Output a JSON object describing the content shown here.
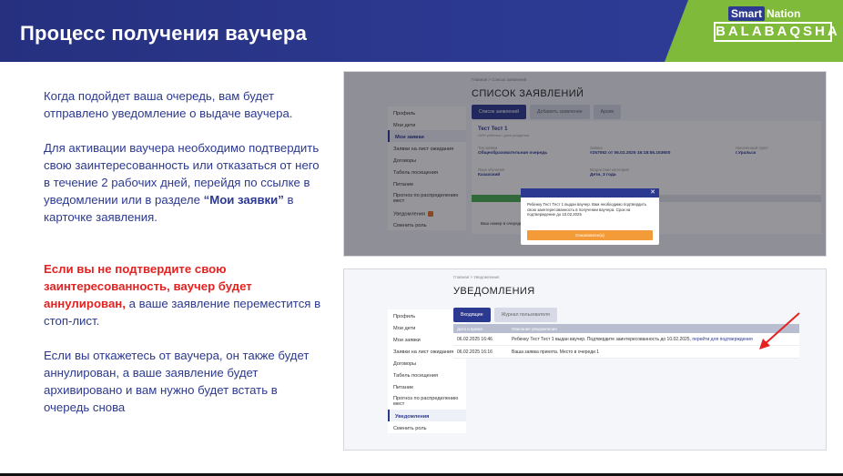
{
  "header": {
    "title": "Процесс получения ваучера",
    "logo_top_smart": "Smart",
    "logo_top_nation": "Nation",
    "logo_bottom": "BALABAQSHA",
    "colors": {
      "brand_blue": "#2c3990",
      "brand_green": "#7fba3a",
      "alert_red": "#e32222"
    }
  },
  "text": {
    "p1": "Когда подойдет ваша очередь, вам будет отправлено уведомление о выдаче ваучера.",
    "p2_a": "Для активации ваучера необходимо подтвердить свою заинтересованность или отказаться от него в течение 2 рабочих дней, перейдя по ссылке в уведомлении или в разделе ",
    "p2_bold": "“Мои заявки”",
    "p2_b": " в карточке заявления.",
    "p3_red": "Если вы не подтвердите свою заинтересованность, ваучер будет аннулирован,",
    "p3_rest": " а ваше заявление переместится в стоп-лист.",
    "p4": "Если вы откажетесь от ваучера, он также будет аннулирован, а ваше заявление будет архивировано и вам нужно будет встать в очередь снова"
  },
  "shot1": {
    "breadcrumb": "Главная  >  Список заявлений",
    "title": "СПИСОК ЗАЯВЛЕНИЙ",
    "tabs": [
      "Список заявлений",
      "Добавить заявление",
      "Архив"
    ],
    "sidebar": [
      "Профиль",
      "Мои дети",
      "Мои заявки",
      "Заявки на лист ожидания",
      "Договоры",
      "Табель посещения",
      "Питание",
      "Прогноз по распределению мест",
      "Уведомления",
      "Сменить роль"
    ],
    "card": {
      "name": "Тест Тест 1",
      "sub": "ИИН ребенка / дата рождения",
      "type_label": "Тип заявки",
      "type_value": "Общеобразовательная очередь",
      "number_label": "Заявка",
      "number_value": "#257062 от 06.02.2025 16:18:55.153600",
      "region_label": "Населенный пункт",
      "region_value": "г.Уральск",
      "lang_label": "Язык обучения",
      "lang_value": "Казахский",
      "age_label": "Возрастная категория",
      "age_value": "Дети, 3 года",
      "queue_label": "Ваш номер в очереди"
    },
    "modal": {
      "text": "Ребенку Тест Тест 1 выдан ваучер. Вам необходимо подтвердить свою заинтересованность в получении ваучера. Срок на подтверждение до 10.02.2025",
      "button": "Ознакомлен(а)"
    }
  },
  "shot2": {
    "breadcrumb": "Главная  >  Уведомления",
    "title": "УВЕДОМЛЕНИЯ",
    "tabs": [
      "Входящие",
      "Журнал пользователя"
    ],
    "sidebar": [
      "Профиль",
      "Мои дети",
      "Мои заявки",
      "Заявки на лист ожидания",
      "Договоры",
      "Табель посещения",
      "Питание",
      "Прогноз по распределению мест",
      "Уведомления",
      "Сменить роль"
    ],
    "table": {
      "headers": [
        "Дата и время",
        "Описание уведомления"
      ],
      "rows": [
        {
          "date": "06.02.2025 16:46",
          "text": "Ребенку Тест Тест 1 выдан ваучер. Подтвердите заинтересованность до 10.02.2025, ",
          "link": "перейти для подтверждения"
        },
        {
          "date": "06.02.2025 16:16",
          "text": "Ваша заявка принята. Место в очереди 1",
          "link": ""
        }
      ]
    }
  }
}
